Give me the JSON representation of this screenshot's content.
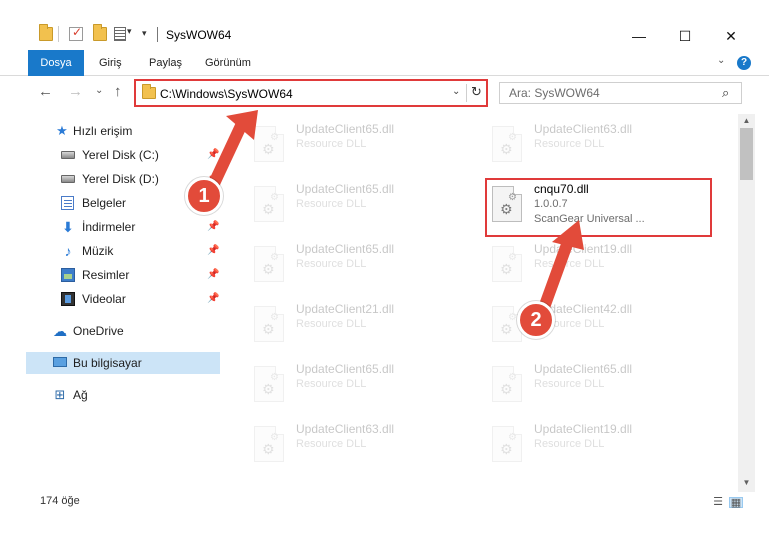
{
  "window": {
    "title": "SysWOW64",
    "qa_dropdown": "▾",
    "minimize": "—",
    "maximize": "☐",
    "close": "✕"
  },
  "ribbon": {
    "tabs": [
      "Dosya",
      "Giriş",
      "Paylaş",
      "Görünüm"
    ],
    "expand": "⌄",
    "help": "?"
  },
  "nav": {
    "back": "←",
    "forward": "→",
    "recent": "⌄",
    "up": "↑"
  },
  "address": {
    "path": "C:\\Windows\\SysWOW64",
    "dropdown": "⌄",
    "refresh": "↻"
  },
  "search": {
    "placeholder": "Ara: SysWOW64",
    "icon": "⌕"
  },
  "sidebar": {
    "pin": "📌",
    "items": [
      {
        "label": "Hızlı erişim",
        "icon": "star-icon"
      },
      {
        "label": "Yerel Disk (C:)",
        "icon": "drive-icon",
        "pinned": true
      },
      {
        "label": "Yerel Disk (D:)",
        "icon": "drive-icon",
        "pinned": true
      },
      {
        "label": "Belgeler",
        "icon": "documents-icon",
        "pinned": true
      },
      {
        "label": "İndirmeler",
        "icon": "download-icon",
        "pinned": true
      },
      {
        "label": "Müzik",
        "icon": "music-icon",
        "pinned": true
      },
      {
        "label": "Resimler",
        "icon": "pictures-icon",
        "pinned": true
      },
      {
        "label": "Videolar",
        "icon": "video-icon",
        "pinned": true
      },
      {
        "label": "OneDrive",
        "icon": "onedrive-icon"
      },
      {
        "label": "Bu bilgisayar",
        "icon": "computer-icon",
        "selected": true
      },
      {
        "label": "Ağ",
        "icon": "network-icon"
      }
    ]
  },
  "files": {
    "left": [
      {
        "name": "UpdateClient65.dll",
        "sub": "Resource DLL"
      },
      {
        "name": "UpdateClient65.dll",
        "sub": "Resource DLL"
      },
      {
        "name": "UpdateClient65.dll",
        "sub": "Resource DLL"
      },
      {
        "name": "UpdateClient21.dll",
        "sub": "Resource DLL"
      },
      {
        "name": "UpdateClient65.dll",
        "sub": "Resource DLL"
      },
      {
        "name": "UpdateClient63.dll",
        "sub": "Resource DLL"
      }
    ],
    "right": [
      {
        "name": "UpdateClient63.dll",
        "sub": "Resource DLL"
      },
      {
        "name": "cnqu70.dll",
        "sub": "1.0.0.7",
        "sub2": "ScanGear Universal ..."
      },
      {
        "name": "UpdateClient19.dll",
        "sub": "Resource DLL"
      },
      {
        "name": "UpdateClient42.dll",
        "sub": "Resource DLL"
      },
      {
        "name": "UpdateClient65.dll",
        "sub": "Resource DLL"
      },
      {
        "name": "UpdateClient19.dll",
        "sub": "Resource DLL"
      }
    ]
  },
  "annotations": {
    "step1": "1",
    "step2": "2"
  },
  "status": {
    "count": "174 öğe",
    "view_details": "☰",
    "view_tiles": "▦"
  },
  "scroll": {
    "up": "▲",
    "down": "▼"
  },
  "colors": {
    "accent": "#1979ca",
    "annotation": "#e24b3a",
    "highlight_border": "#e03a3a",
    "selected_bg": "#cce4f7"
  }
}
